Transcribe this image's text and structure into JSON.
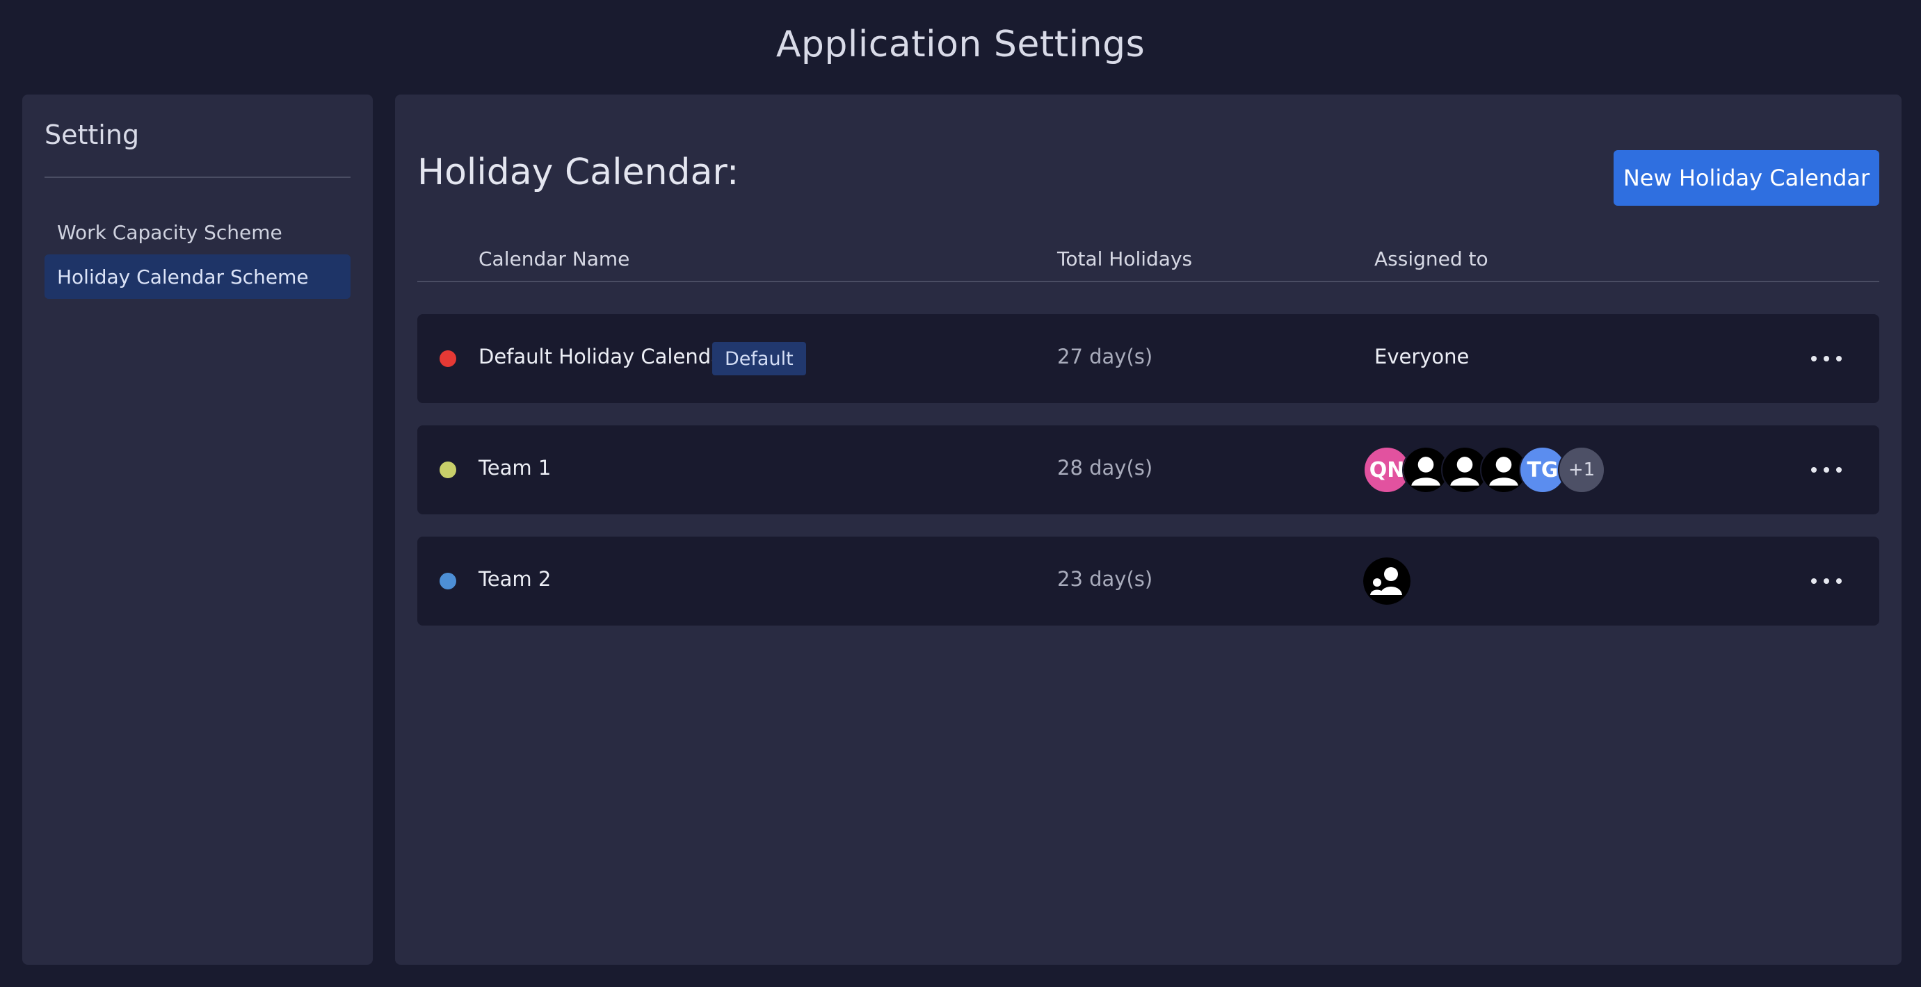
{
  "page": {
    "title": "Application Settings"
  },
  "sidebar": {
    "title": "Setting",
    "items": [
      {
        "label": "Work Capacity Scheme",
        "active": false
      },
      {
        "label": "Holiday Calendar Scheme",
        "active": true
      }
    ]
  },
  "main": {
    "title": "Holiday Calendar:",
    "new_button_label": "New Holiday Calendar",
    "columns": {
      "name": "Calendar Name",
      "total": "Total Holidays",
      "assigned": "Assigned to"
    },
    "rows": [
      {
        "name": "Default Holiday Calendar",
        "badge": "Default",
        "dot_color": "#e53935",
        "total": "27 day(s)",
        "assigned_text": "Everyone"
      },
      {
        "name": "Team 1",
        "dot_color": "#c8cf6a",
        "total": "28 day(s)",
        "avatars": [
          {
            "type": "initials",
            "text": "QN",
            "color": "#e2529f"
          },
          {
            "type": "user-icon"
          },
          {
            "type": "user-icon"
          },
          {
            "type": "user-icon"
          },
          {
            "type": "initials",
            "text": "TG",
            "color": "#5b8def"
          },
          {
            "type": "more",
            "text": "+1",
            "color": "#4d5066"
          }
        ]
      },
      {
        "name": "Team 2",
        "dot_color": "#4d8fd6",
        "total": "23 day(s)",
        "avatars": [
          {
            "type": "team-icon"
          }
        ]
      }
    ]
  },
  "colors": {
    "background": "#191b2f",
    "panel": "#292b42",
    "row": "#191a2e",
    "accent": "#2f6fe0",
    "active_item": "#1e3467"
  }
}
